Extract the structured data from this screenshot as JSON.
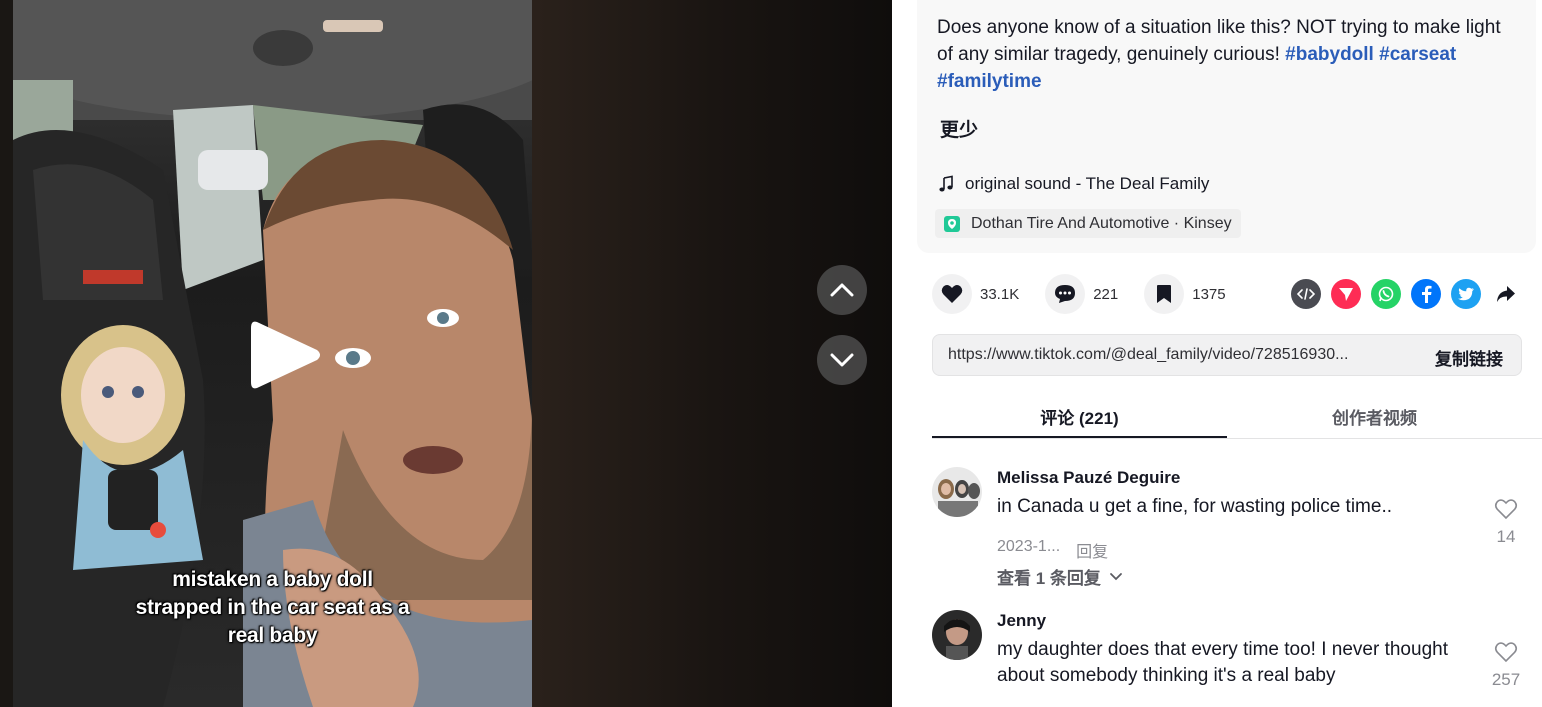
{
  "video": {
    "caption_lines": [
      "mistaken a baby doll",
      "strapped in the car seat as a",
      "real baby"
    ]
  },
  "description": {
    "text": "Does anyone know of a situation like this? NOT trying to make light of any similar tragedy, genuinely curious! ",
    "hashtags": [
      "#babydoll",
      "#carseat",
      "#familytime"
    ],
    "less_label": "更少"
  },
  "sound": {
    "icon": "music-note-icon",
    "label": "original sound - The Deal Family"
  },
  "location": {
    "icon": "location-pin-icon",
    "label": "Dothan Tire And Automotive · Kinsey"
  },
  "actions": {
    "likes": "33.1K",
    "comments": "221",
    "saves": "1375"
  },
  "share": {
    "icons": [
      "embed-icon",
      "send-icon",
      "whatsapp-icon",
      "facebook-icon",
      "twitter-icon",
      "share-arrow-icon"
    ],
    "colors": {
      "embed": "#4a4b52",
      "send": "#fe2c55",
      "whatsapp": "#25d366",
      "facebook": "#0075fa",
      "twitter": "#1da1f2"
    }
  },
  "link": {
    "url": "https://www.tiktok.com/@deal_family/video/728516930...",
    "copy_label": "复制链接"
  },
  "tabs": {
    "comments": "评论 (221)",
    "creator_videos": "创作者视频"
  },
  "comments": [
    {
      "user": "Melissa Pauzé Deguire",
      "text": "in Canada u get a fine, for wasting police time..",
      "date": "2023-1...",
      "reply_label": "回复",
      "likes": "14",
      "view_replies": "查看 1 条回复"
    },
    {
      "user": "Jenny",
      "text": "my daughter does that every time too! I never thought about somebody thinking it's a real baby",
      "likes": "257"
    }
  ],
  "accent_color": "#fe2c55",
  "hashtag_color": "#2b5db9"
}
